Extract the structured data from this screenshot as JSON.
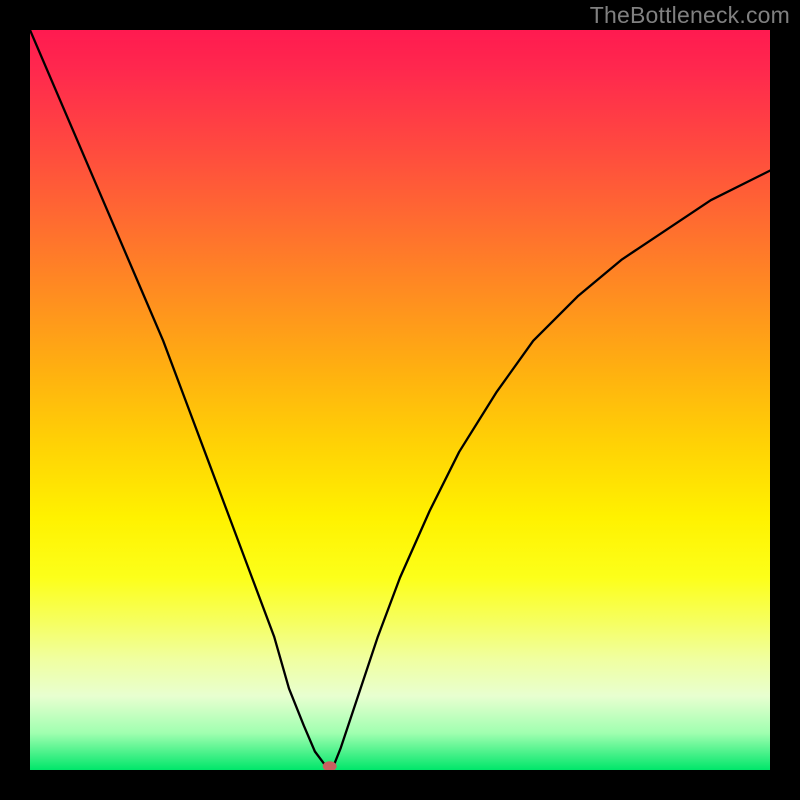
{
  "watermark": "TheBottleneck.com",
  "chart_data": {
    "type": "line",
    "title": "",
    "xlabel": "",
    "ylabel": "",
    "xlim": [
      0,
      100
    ],
    "ylim": [
      0,
      100
    ],
    "grid": false,
    "legend": false,
    "lines": [
      {
        "name": "left-branch",
        "x": [
          0,
          3,
          6,
          9,
          12,
          15,
          18,
          21,
          24,
          27,
          30,
          33,
          35,
          37,
          38.5,
          40
        ],
        "y": [
          100,
          93,
          86,
          79,
          72,
          65,
          58,
          50,
          42,
          34,
          26,
          18,
          11,
          6,
          2.5,
          0.5
        ]
      },
      {
        "name": "right-branch",
        "x": [
          41,
          42,
          44,
          47,
          50,
          54,
          58,
          63,
          68,
          74,
          80,
          86,
          92,
          98,
          100
        ],
        "y": [
          0.5,
          3,
          9,
          18,
          26,
          35,
          43,
          51,
          58,
          64,
          69,
          73,
          77,
          80,
          81
        ]
      }
    ],
    "marker": {
      "x": 40.5,
      "y": 0.5,
      "color": "#c86060"
    },
    "background_gradient": {
      "top": "#ff1a50",
      "middle": "#fff200",
      "bottom": "#00e66a"
    }
  }
}
